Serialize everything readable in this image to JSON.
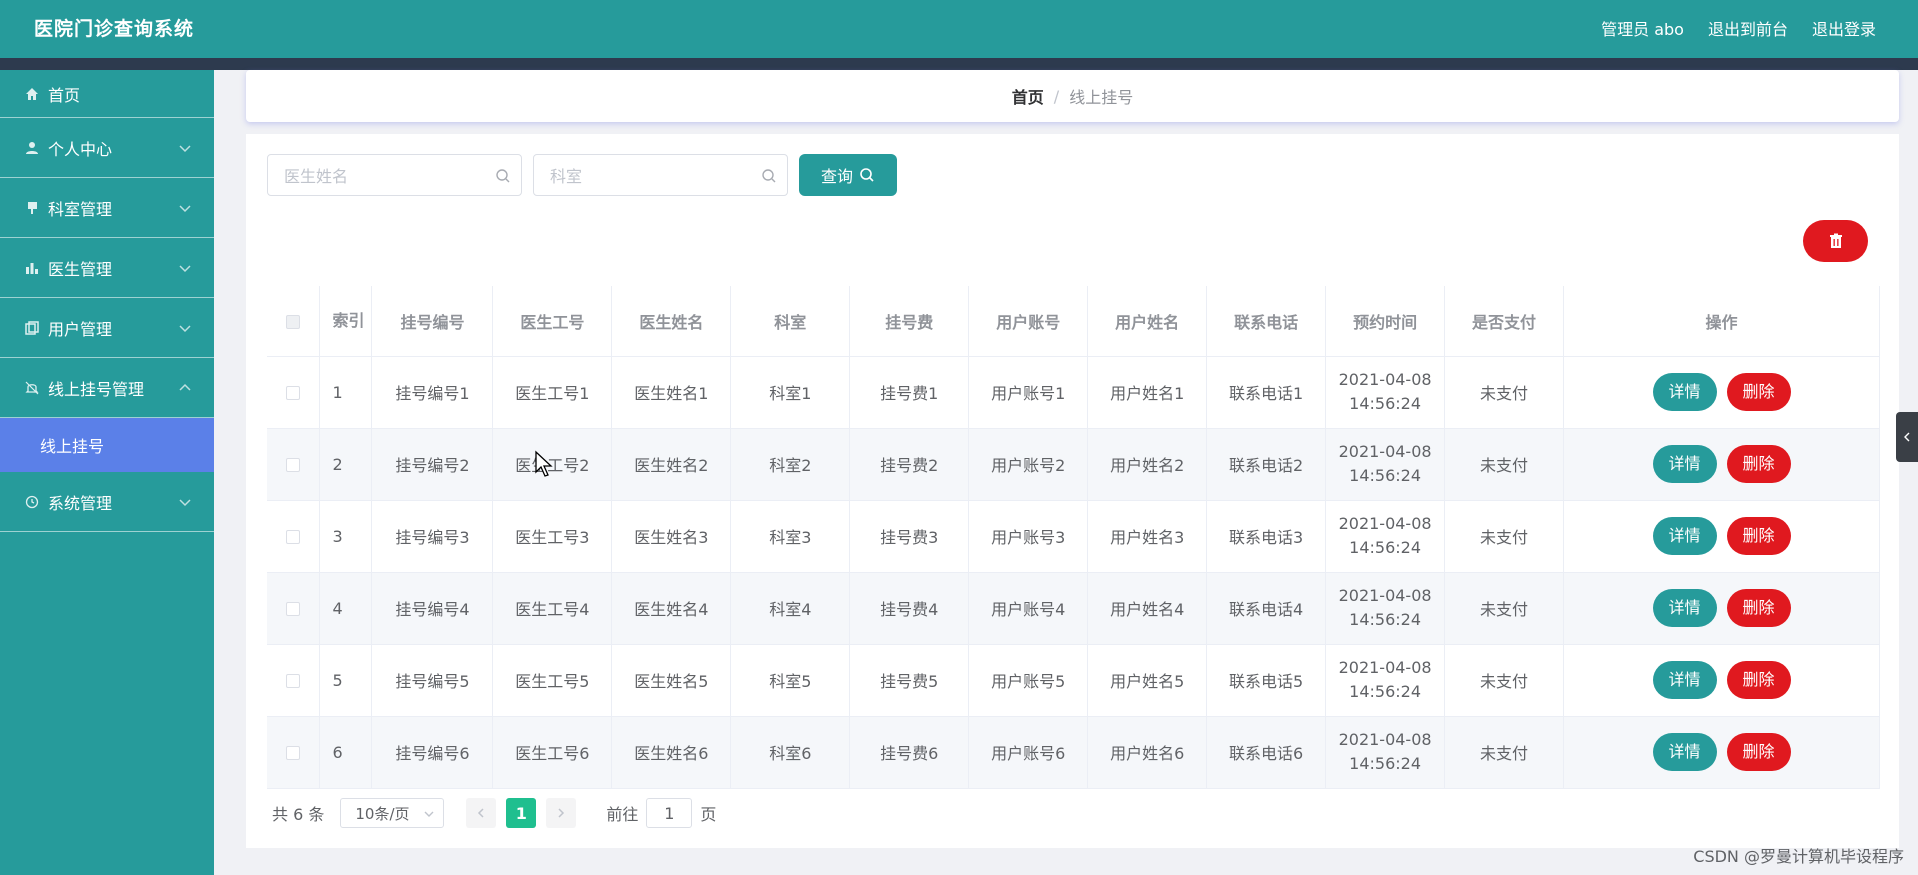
{
  "header": {
    "title": "医院门诊查询系统",
    "admin_label": "管理员 abo",
    "to_front": "退出到前台",
    "logout": "退出登录",
    "color": "#269b9b"
  },
  "sidebar": {
    "items": [
      {
        "label": "首页",
        "icon": "home-icon"
      },
      {
        "label": "个人中心",
        "icon": "user-icon"
      },
      {
        "label": "科室管理",
        "icon": "flag-icon"
      },
      {
        "label": "医生管理",
        "icon": "bar-chart-icon"
      },
      {
        "label": "用户管理",
        "icon": "copy-icon"
      },
      {
        "label": "线上挂号管理",
        "icon": "bell-icon"
      },
      {
        "label": "系统管理",
        "icon": "clock-icon"
      }
    ],
    "sub_item": "线上挂号",
    "active_color": "#5b80e8"
  },
  "breadcrumb": {
    "home": "首页",
    "sep": "/",
    "current": "线上挂号"
  },
  "search": {
    "doctor_placeholder": "医生姓名",
    "dept_placeholder": "科室",
    "query_label": "查询"
  },
  "table": {
    "headers": [
      "索引",
      "挂号编号",
      "医生工号",
      "医生姓名",
      "科室",
      "挂号费",
      "用户账号",
      "用户姓名",
      "联系电话",
      "预约时间",
      "是否支付",
      "操作"
    ],
    "rows": [
      {
        "idx": "1",
        "reg_no": "挂号编号1",
        "doc_id": "医生工号1",
        "doc_name": "医生姓名1",
        "dept": "科室1",
        "fee": "挂号费1",
        "account": "用户账号1",
        "user_name": "用户姓名1",
        "phone": "联系电话1",
        "date": "2021-04-08",
        "time": "14:56:24",
        "paid": "未支付"
      },
      {
        "idx": "2",
        "reg_no": "挂号编号2",
        "doc_id": "医生工号2",
        "doc_name": "医生姓名2",
        "dept": "科室2",
        "fee": "挂号费2",
        "account": "用户账号2",
        "user_name": "用户姓名2",
        "phone": "联系电话2",
        "date": "2021-04-08",
        "time": "14:56:24",
        "paid": "未支付"
      },
      {
        "idx": "3",
        "reg_no": "挂号编号3",
        "doc_id": "医生工号3",
        "doc_name": "医生姓名3",
        "dept": "科室3",
        "fee": "挂号费3",
        "account": "用户账号3",
        "user_name": "用户姓名3",
        "phone": "联系电话3",
        "date": "2021-04-08",
        "time": "14:56:24",
        "paid": "未支付"
      },
      {
        "idx": "4",
        "reg_no": "挂号编号4",
        "doc_id": "医生工号4",
        "doc_name": "医生姓名4",
        "dept": "科室4",
        "fee": "挂号费4",
        "account": "用户账号4",
        "user_name": "用户姓名4",
        "phone": "联系电话4",
        "date": "2021-04-08",
        "time": "14:56:24",
        "paid": "未支付"
      },
      {
        "idx": "5",
        "reg_no": "挂号编号5",
        "doc_id": "医生工号5",
        "doc_name": "医生姓名5",
        "dept": "科室5",
        "fee": "挂号费5",
        "account": "用户账号5",
        "user_name": "用户姓名5",
        "phone": "联系电话5",
        "date": "2021-04-08",
        "time": "14:56:24",
        "paid": "未支付"
      },
      {
        "idx": "6",
        "reg_no": "挂号编号6",
        "doc_id": "医生工号6",
        "doc_name": "医生姓名6",
        "dept": "科室6",
        "fee": "挂号费6",
        "account": "用户账号6",
        "user_name": "用户姓名6",
        "phone": "联系电话6",
        "date": "2021-04-08",
        "time": "14:56:24",
        "paid": "未支付"
      }
    ],
    "detail_label": "详情",
    "delete_label": "删除"
  },
  "pager": {
    "total": "共 6 条",
    "page_size": "10条/页",
    "current": "1",
    "goto_label": "前往",
    "goto_value": "1",
    "page_suffix": "页"
  },
  "watermark": "CSDN @罗曼计算机毕设程序"
}
